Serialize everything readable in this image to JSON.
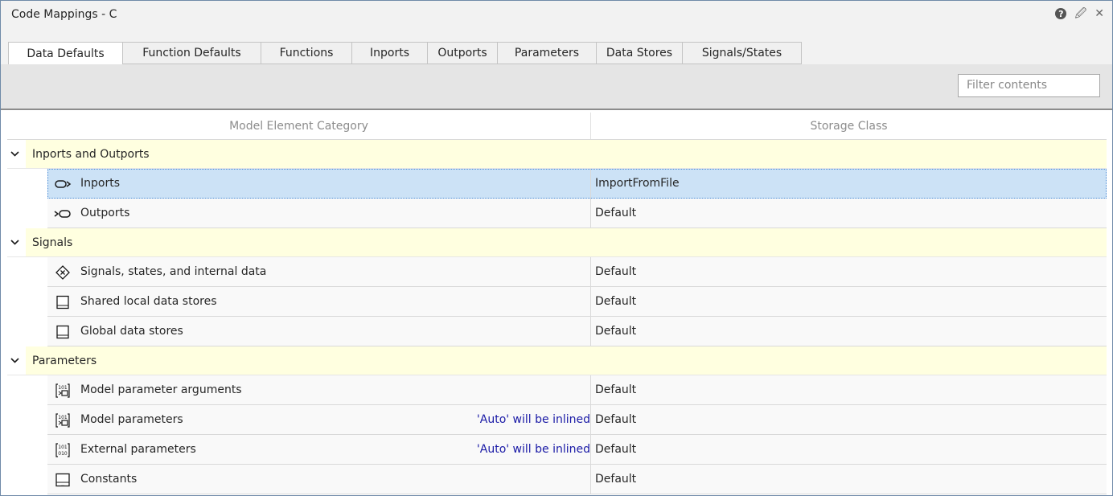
{
  "window": {
    "title": "Code Mappings - C"
  },
  "tabs": [
    "Data Defaults",
    "Function Defaults",
    "Functions",
    "Inports",
    "Outports",
    "Parameters",
    "Data Stores",
    "Signals/States"
  ],
  "active_tab": "Data Defaults",
  "filter": {
    "placeholder": "Filter contents"
  },
  "table": {
    "columns": {
      "category": "Model Element Category",
      "storage": "Storage Class"
    },
    "groups": [
      {
        "label": "Inports and Outports",
        "rows": [
          {
            "name": "Inports",
            "icon": "inport-icon",
            "note": "",
            "storage": "ImportFromFile",
            "selected": true
          },
          {
            "name": "Outports",
            "icon": "outport-icon",
            "note": "",
            "storage": "Default"
          }
        ]
      },
      {
        "label": "Signals",
        "rows": [
          {
            "name": "Signals, states, and internal data",
            "icon": "signal-icon",
            "note": "",
            "storage": "Default"
          },
          {
            "name": "Shared local data stores",
            "icon": "data-store-icon",
            "note": "",
            "storage": "Default"
          },
          {
            "name": "Global data stores",
            "icon": "data-store-icon",
            "note": "",
            "storage": "Default"
          }
        ]
      },
      {
        "label": "Parameters",
        "rows": [
          {
            "name": "Model parameter arguments",
            "icon": "model-parameter-icon",
            "note": "",
            "storage": "Default"
          },
          {
            "name": "Model parameters",
            "icon": "model-parameter-icon",
            "note": "'Auto' will be inlined",
            "storage": "Default"
          },
          {
            "name": "External parameters",
            "icon": "external-parameter-icon",
            "note": "'Auto' will be inlined",
            "storage": "Default"
          },
          {
            "name": "Constants",
            "icon": "constant-icon",
            "note": "",
            "storage": "Default"
          }
        ]
      }
    ]
  }
}
